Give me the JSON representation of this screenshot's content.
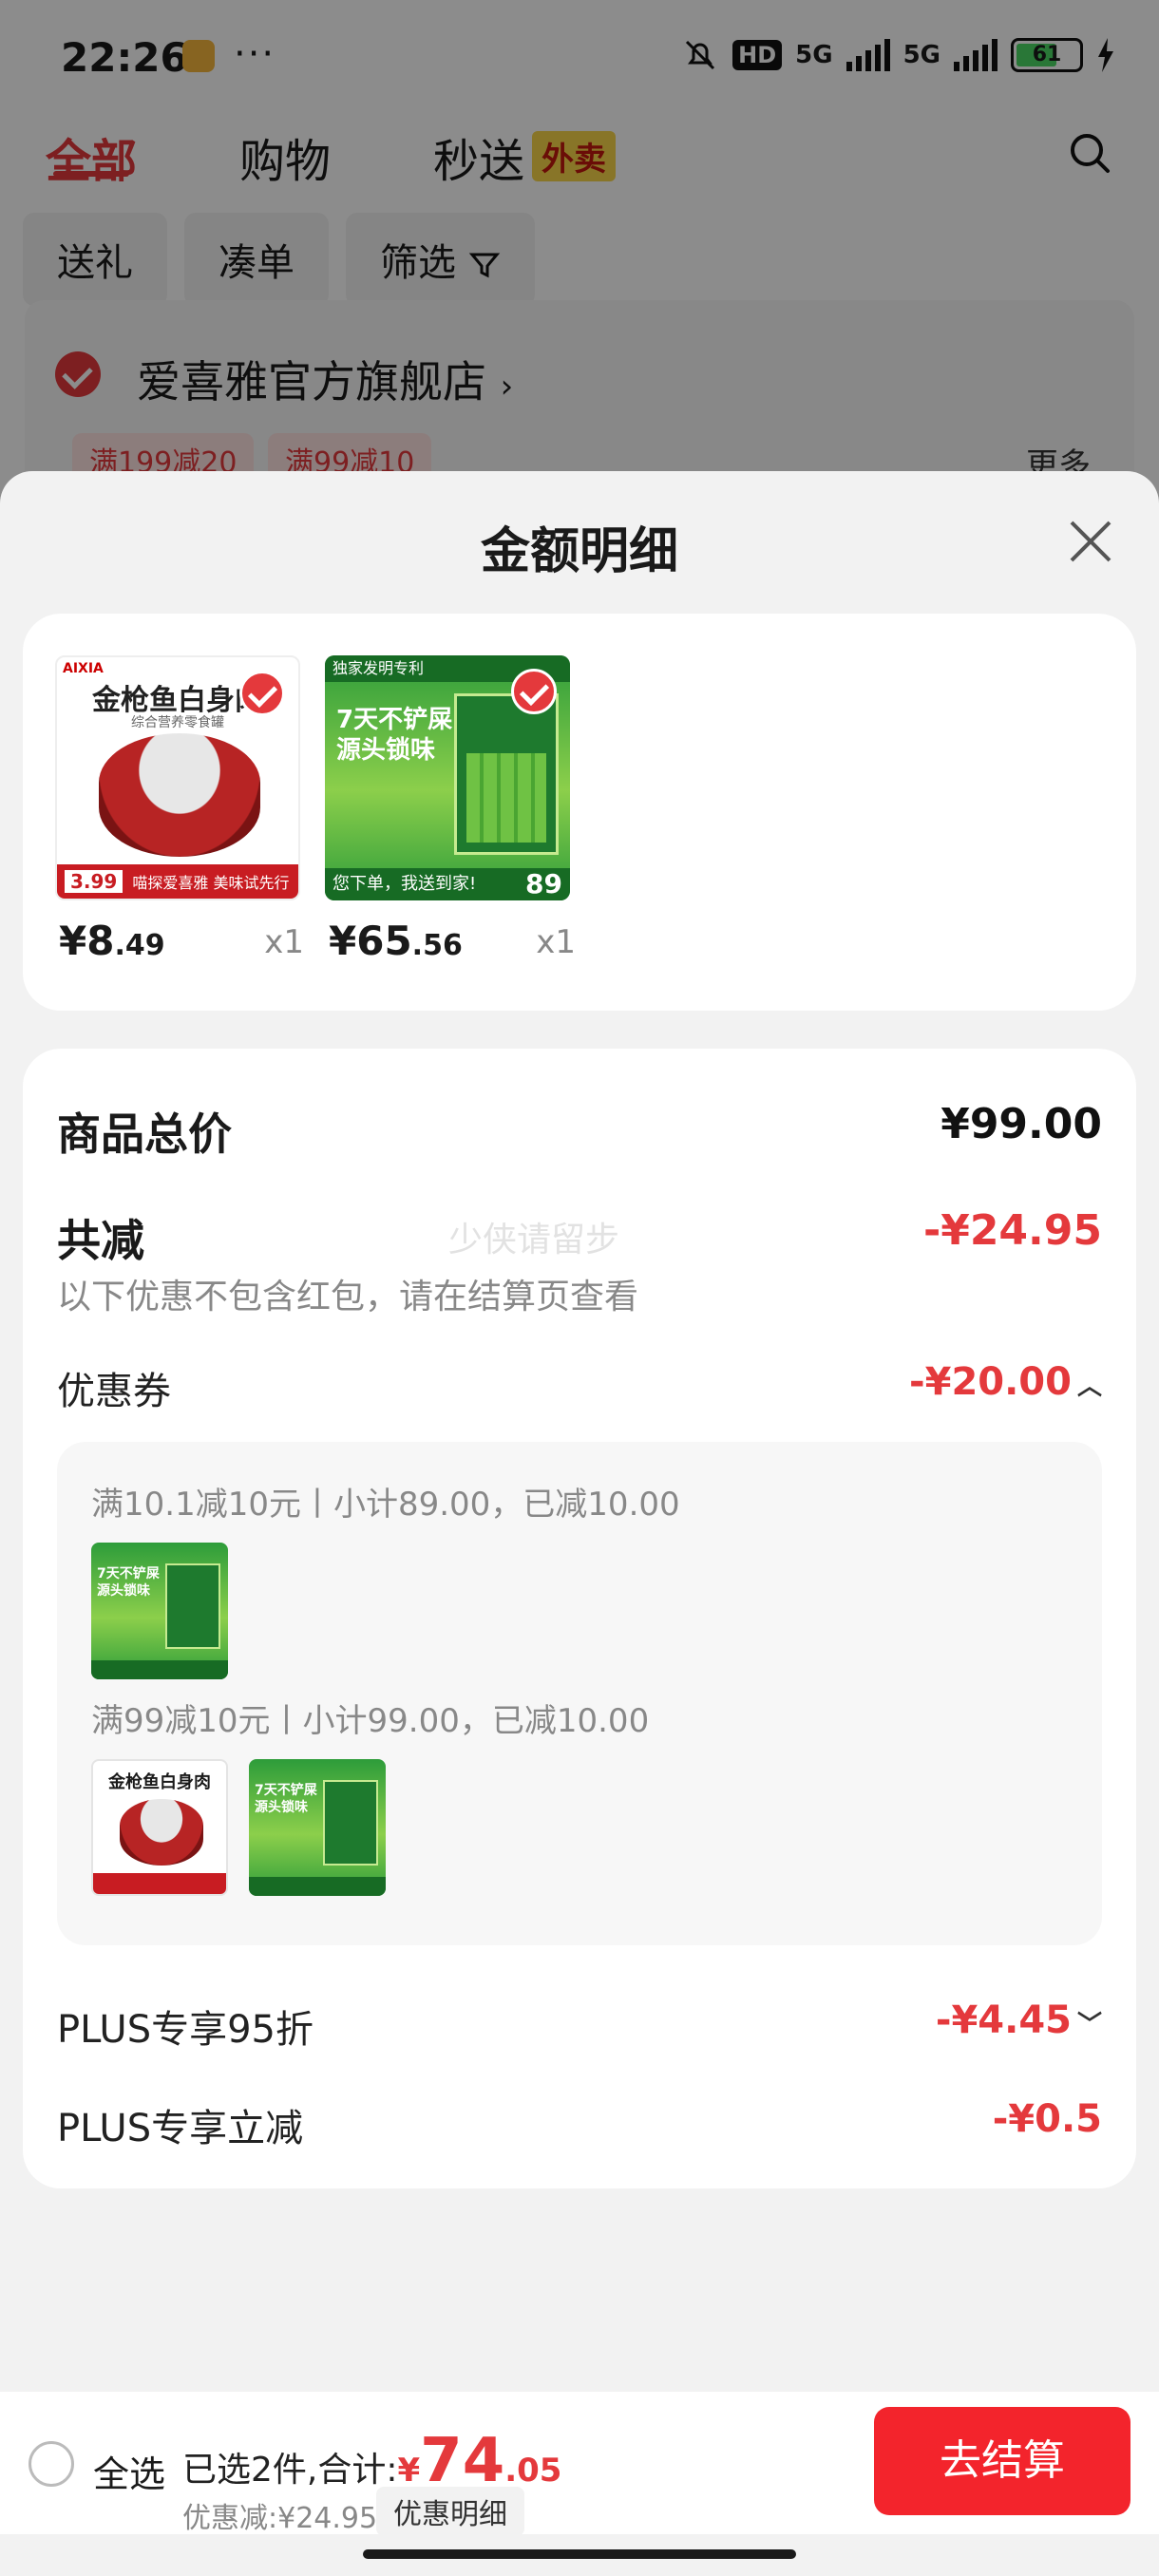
{
  "status_bar": {
    "time": "22:26",
    "dots": "···",
    "hd": "HD",
    "net1": "5G",
    "net2": "5G",
    "battery": "61"
  },
  "top_nav": {
    "tabs": [
      "全部",
      "购物",
      "秒送"
    ],
    "waimai_badge": "外卖",
    "active_color": "#e4393c"
  },
  "filters": [
    "送礼",
    "凑单",
    "筛选"
  ],
  "store": {
    "name": "爱喜雅官方旗舰店",
    "promos": [
      "满199减20",
      "满99减10"
    ],
    "more": "更多"
  },
  "sheet": {
    "title": "金额明细",
    "products": [
      {
        "price_int": "¥8",
        "price_dec": ".49",
        "qty": "x1",
        "img_title": "金枪鱼白身肉",
        "img_brand": "AIXIA",
        "img_sub": "综合营养零食罐",
        "img_price": "3.99",
        "img_bar": "喵探爱喜雅 美味试先行"
      },
      {
        "price_int": "¥65",
        "price_dec": ".56",
        "qty": "x1",
        "img_header": "独家发明专利",
        "img_title": "7天不铲屎源头锁味",
        "img_bar": "您下单，我送到家!",
        "img_price": "89"
      }
    ],
    "total_label": "商品总价",
    "total_value": "¥99.00",
    "discount_label": "共减",
    "discount_value": "-¥24.95",
    "note": "以下优惠不包含红包，请在结算页查看",
    "watermark": "少侠请留步",
    "coupon_label": "优惠券",
    "coupon_value": "-¥20.00",
    "coupon_lines": [
      "满10.1减10元丨小计89.00，已减10.00",
      "满99减10元丨小计99.00，已减10.00"
    ],
    "mini_tuna_title": "金枪鱼白身肉",
    "mini_litter_title": "7天不铲屎源头锁味",
    "plus95_label": "PLUS专享95折",
    "plus95_value": "-¥4.45",
    "plus_cut_label": "PLUS专享立减",
    "plus_cut_value": "-¥0.5"
  },
  "bottom_bar": {
    "select_all": "全选",
    "summary_prefix": "已选2件,合计:",
    "currency": "¥",
    "amount_int": "74",
    "amount_dec": ".05",
    "discount_text": "优惠减:¥24.95",
    "detail_button": "优惠明细",
    "checkout": "去结算"
  }
}
